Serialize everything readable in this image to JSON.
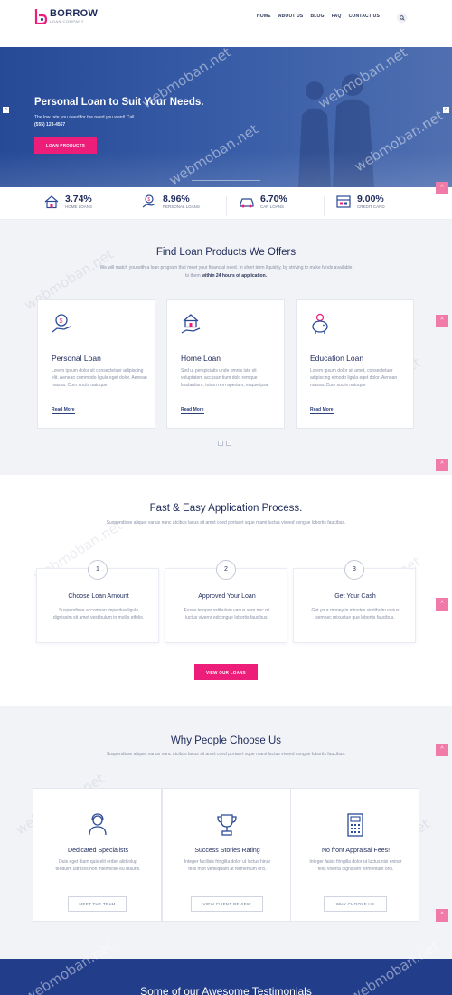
{
  "brand": {
    "name": "BORROW",
    "tagline": "LOAN COMPANY",
    "accent": "#ec1e79",
    "primary": "#2b4a97"
  },
  "nav": [
    "HOME",
    "ABOUT US",
    "BLOG",
    "FAQ",
    "CONTACT US"
  ],
  "hero": {
    "title": "Personal Loan to Suit Your Needs.",
    "subtitle": "The low rate you need for the need you want! Call",
    "phone": "(555) 123-4567",
    "cta": "LOAN PRODUCTS"
  },
  "stats": [
    {
      "value": "3.74%",
      "label": "HOME LOANS",
      "icon": "house-loan-icon"
    },
    {
      "value": "8.96%",
      "label": "PERSONAL LOANS",
      "icon": "hand-coin-icon"
    },
    {
      "value": "6.70%",
      "label": "CAR LOANS",
      "icon": "car-icon"
    },
    {
      "value": "9.00%",
      "label": "CREDIT CARD",
      "icon": "calendar-card-icon"
    }
  ],
  "loans": {
    "title": "Find Loan Products We Offers",
    "desc_plain": "We will match you with a loan program that meet your financial need. In short term liquidity, by striving to make funds available to them",
    "desc_bold": "within 24 hours of application.",
    "cards": [
      {
        "title": "Personal Loan",
        "text": "Lorem ipsum dolor sit consectetuer adipiscing elit. Aenean commodo ligula eget dolor. Aenean massa. Cum sociis natoque",
        "link": "Read More",
        "icon": "hand-money-icon"
      },
      {
        "title": "Home Loan",
        "text": "Sed ut perspiciatis unde omnis iste sit voluptatem accusan tium dolo remque laudantium, totam rem aperiam, eaque ipsa",
        "link": "Read More",
        "icon": "hand-house-icon"
      },
      {
        "title": "Education Loan",
        "text": "Lorem ipsum dolor sit amet, consectetuer adipiscing elmodo ligula eget dolor. Aenean massa. Cum sociis natoque",
        "link": "Read More",
        "icon": "piggy-bank-icon"
      }
    ],
    "dots": [
      "<",
      ">"
    ]
  },
  "process": {
    "title": "Fast & Easy Application Process.",
    "desc": "Suspendisse aliquet varius nunc atcibus lacus sit amet coed portaort sque mami luctus viveed congue lobortis faucibus.",
    "steps": [
      {
        "num": "1",
        "title": "Choose Loan Amount",
        "text": "Suspendisse accumsan imperdue ligula dignissim sit amet vestibulum in mollis etfelis."
      },
      {
        "num": "2",
        "title": "Approved Your Loan",
        "text": "Fusce tempor sstibulum varius sem nec mi luctus viverra edcongue lobortis faucibus."
      },
      {
        "num": "3",
        "title": "Get Your Cash",
        "text": "Get your money in minutes simtibulm varius semnec mixuctue gue lobortis faucibus."
      }
    ],
    "cta": "VIEW OUR LOANS"
  },
  "why": {
    "title": "Why People Choose Us",
    "desc": "Suspendisse aliquet varius nunc atcibus lacus sit amet coed portaort sque mami luctus viveed congue lobortis faucibus.",
    "cards": [
      {
        "title": "Dedicated Specialists",
        "text": "Duis eget diam quis elit erdiet alidvolup tenduim ultricies non intewsolle eu mauris.",
        "button": "MEET THE TEAM",
        "icon": "team-icon"
      },
      {
        "title": "Success Stories Rating",
        "text": "Integer facilisis fringilla dolor ut luctus hinar felis mixt vehiliquam at fermentum orci.",
        "button": "VIEW CLIENT REVIEW",
        "icon": "trophy-icon"
      },
      {
        "title": "No front Appraisal Fees!",
        "text": "Integer faisis fringilla dolor ut luctus nisi eninar felis viverra dignissim fermentum orci.",
        "button": "WHY CHOOSE US",
        "icon": "calculator-icon"
      }
    ]
  },
  "testimonials": {
    "title": "Some of our Awesome Testimonials"
  },
  "watermark": "webmoban.net",
  "ui": {
    "back_top": "^",
    "prev": "<",
    "next": ">"
  }
}
